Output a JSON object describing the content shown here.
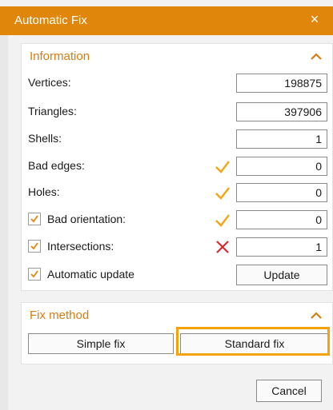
{
  "window": {
    "title": "Automatic Fix",
    "close_glyph": "×"
  },
  "information": {
    "header": "Information",
    "rows": [
      {
        "label": "Vertices:",
        "value": "198875"
      },
      {
        "label": "Triangles:",
        "value": "397906"
      },
      {
        "label": "Shells:",
        "value": "1"
      },
      {
        "label": "Bad edges:",
        "value": "0",
        "status": "ok"
      },
      {
        "label": "Holes:",
        "value": "0",
        "status": "ok"
      },
      {
        "label": "Bad orientation:",
        "value": "0",
        "status": "ok",
        "checked": true
      },
      {
        "label": "Intersections:",
        "value": "1",
        "status": "error",
        "checked": true
      }
    ],
    "auto_update": {
      "label": "Automatic update",
      "checked": true
    },
    "update_button": "Update"
  },
  "fix_method": {
    "header": "Fix method",
    "simple_button": "Simple fix",
    "standard_button": "Standard fix"
  },
  "cancel_button": "Cancel",
  "colors": {
    "accent": "#e0860b",
    "ok": "#f2a516",
    "error": "#d9282f",
    "highlight": "#f4a30a"
  },
  "icons": {
    "collapse": "chevron-up-icon",
    "ok": "check-icon",
    "error": "cross-icon",
    "checkbox": "checkbox-checked-icon"
  }
}
